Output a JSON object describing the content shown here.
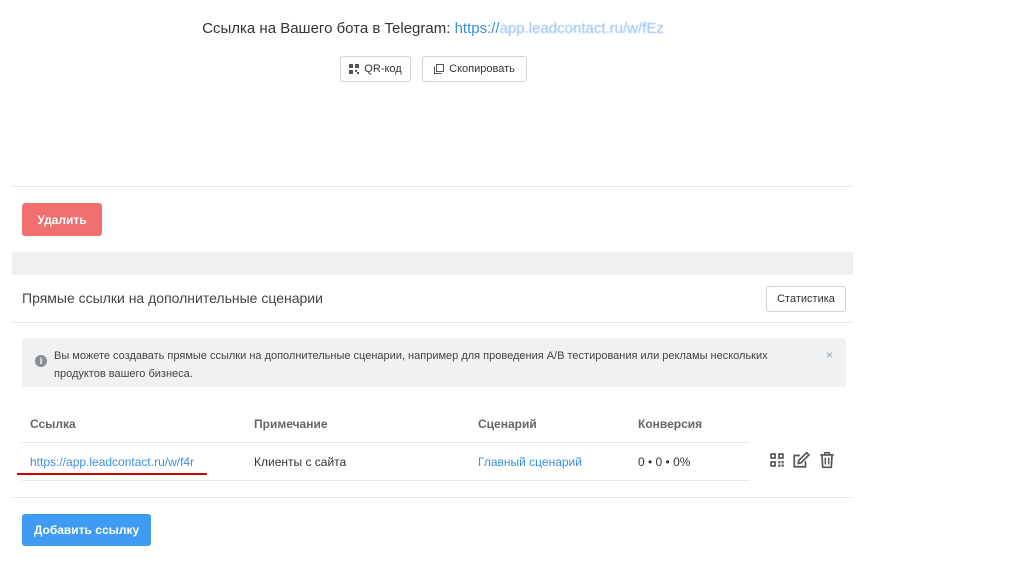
{
  "bot_link": {
    "label": "Ссылка на Вашего бота в Telegram: ",
    "url_prefix": "https://",
    "url_rest": "app.leadcontact.ru/w/fEz"
  },
  "buttons": {
    "qr": "QR-код",
    "copy": "Скопировать",
    "delete": "Удалить",
    "stats": "Статистика",
    "add_link": "Добавить ссылку"
  },
  "section": {
    "title": "Прямые ссылки на дополнительные сценарии"
  },
  "alert": {
    "text": "Вы можете создавать прямые ссылки на дополнительные сценарии, например для проведения A/B тестирования или рекламы нескольких продуктов вашего бизнеса.",
    "icon": "info-icon",
    "close": "×"
  },
  "table": {
    "headers": [
      "Ссылка",
      "Примечание",
      "Сценарий",
      "Конверсия"
    ],
    "rows": [
      {
        "link": "https://app.leadcontact.ru/w/f4r",
        "note": "Клиенты с сайта",
        "scenario": "Главный сценарий",
        "conversion": "0 • 0 • 0%",
        "actions": [
          "qr-code-icon",
          "edit-icon",
          "trash-icon"
        ]
      }
    ]
  },
  "colors": {
    "link": "#3b8fe0",
    "delete": "#f07070",
    "primary": "#3f9cf2",
    "annotation": "#d40000"
  }
}
